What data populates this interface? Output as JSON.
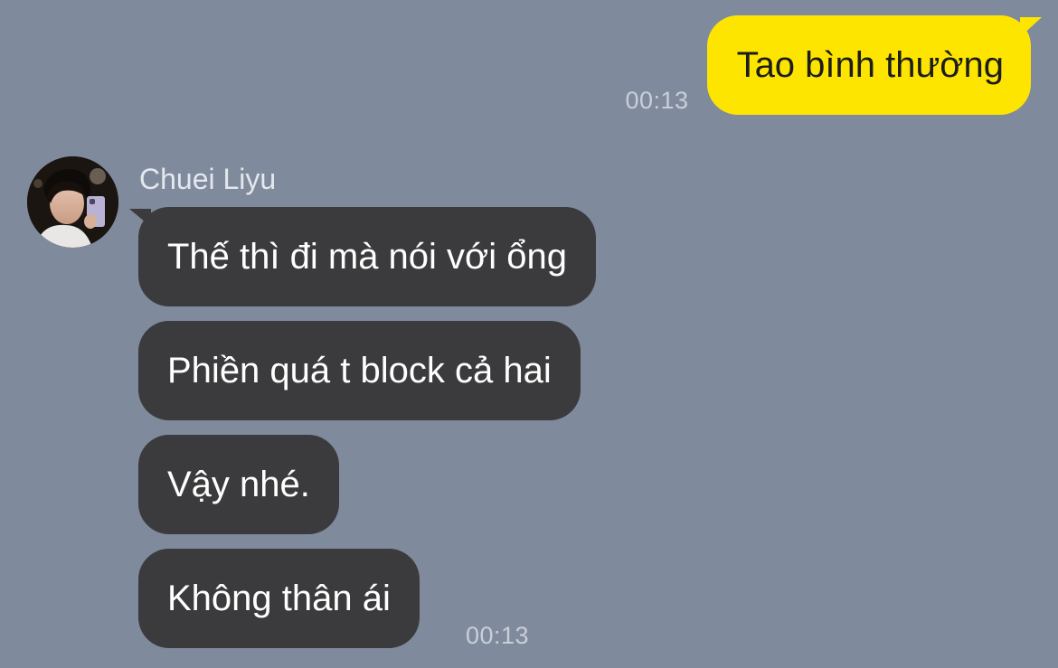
{
  "outgoing": {
    "text": "Tao bình thường",
    "time": "00:13"
  },
  "incoming": {
    "sender": "Chuei Liyu",
    "messages": [
      "Thế thì đi mà nói với ổng",
      "Phiền quá t block cả hai",
      "Vậy nhé.",
      "Không thân ái"
    ],
    "time": "00:13"
  },
  "colors": {
    "background": "#7f8a9c",
    "outgoing_bubble": "#fee500",
    "incoming_bubble": "#3b3b3d"
  }
}
